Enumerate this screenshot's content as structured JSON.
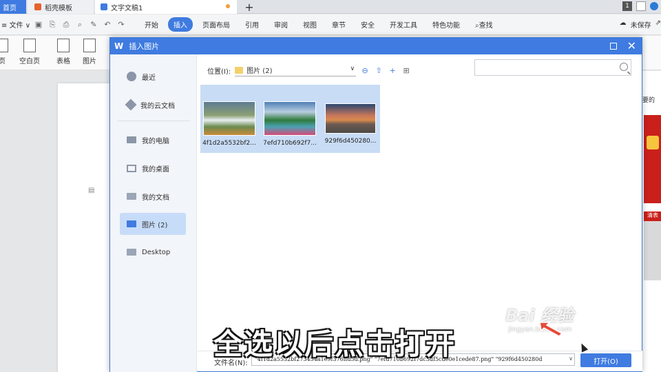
{
  "tabbar": {
    "home_label": "首页",
    "template_label": "稻壳模板",
    "doc_label": "文字文稿1",
    "add_label": "+",
    "badge": "1"
  },
  "menubar": {
    "file_label": "≡ 文件 ∨",
    "tabs": [
      {
        "label": "开始"
      },
      {
        "label": "插入",
        "active": true
      },
      {
        "label": "页面布局"
      },
      {
        "label": "引用"
      },
      {
        "label": "审阅"
      },
      {
        "label": "视图"
      },
      {
        "label": "章节"
      },
      {
        "label": "安全"
      },
      {
        "label": "开发工具"
      },
      {
        "label": "特色功能"
      },
      {
        "label": "查找"
      }
    ],
    "unsaved_label": "未保存",
    "accent_color": "#3f7be0"
  },
  "ribbon": {
    "items": [
      {
        "label": "页"
      },
      {
        "label": "空白页"
      },
      {
        "label": "表格"
      },
      {
        "label": "图片"
      }
    ]
  },
  "right_pane": {
    "hint_text": "要的",
    "card_label": "清表"
  },
  "dialog": {
    "title": "插入图片",
    "logo": "W",
    "sidebar": [
      {
        "label": "最近",
        "icon": "clock-icon"
      },
      {
        "label": "我的云文档",
        "icon": "cloud-doc-icon"
      },
      {
        "label": "我的电脑",
        "icon": "computer-icon"
      },
      {
        "label": "我的桌面",
        "icon": "desktop-icon"
      },
      {
        "label": "我的文档",
        "icon": "folder-icon"
      },
      {
        "label": "图片 (2)",
        "icon": "folder-icon",
        "active": true
      },
      {
        "label": "Desktop",
        "icon": "folder-icon"
      }
    ],
    "location_label": "位置(I):",
    "location_value": "图片 (2)",
    "search_placeholder": "",
    "files": [
      {
        "name": "4f1d2a5532bf2...",
        "thumb": "waterfall"
      },
      {
        "name": "7efd710b692f7...",
        "thumb": "lake"
      },
      {
        "name": "929f6d450280...",
        "thumb": "sunset"
      }
    ],
    "filename_label": "文件名(N):",
    "filename_value": "\"4f1d2a5532bf273454a1e9f376ffd5d.png\" \"7efd710b692f7dc3df5cde0e1cede87.png\" \"929f6d450280d",
    "open_label": "打开(O)"
  },
  "overlay": {
    "caption": "全选以后点击打开",
    "watermark_main": "Bai 经验",
    "watermark_sub": "jingyan.baidu.com"
  }
}
